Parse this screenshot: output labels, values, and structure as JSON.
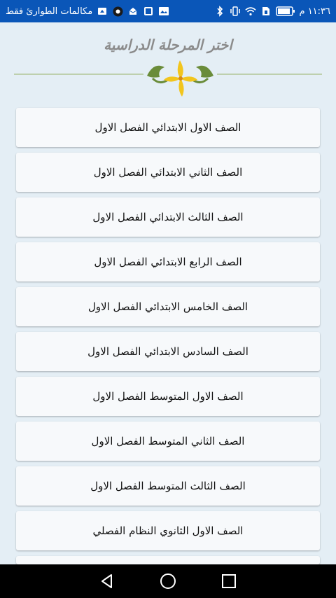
{
  "status_bar": {
    "time": "١١:٣٦ م",
    "carrier_text": "مكالمات الطوارئ فقط",
    "icons": [
      "battery-icon",
      "sim-icon",
      "wifi-icon",
      "vibrate-icon",
      "bluetooth-icon",
      "screenshot-icon",
      "photo-icon",
      "mail-icon",
      "shield-icon",
      "notification-icon"
    ],
    "background_color": "#0a56b8"
  },
  "header": {
    "title": "اختر المرحلة الدراسية",
    "ornament_icon": "floral-ornament-icon"
  },
  "grades": [
    {
      "label": "الصف الاول الابتدائي الفصل الاول"
    },
    {
      "label": "الصف الثاني الابتدائي الفصل الاول"
    },
    {
      "label": "الصف الثالث الابتدائي الفصل الاول"
    },
    {
      "label": "الصف الرابع الابتدائي الفصل الاول"
    },
    {
      "label": "الصف الخامس الابتدائي الفصل الاول"
    },
    {
      "label": "الصف السادس الابتدائي الفصل الاول"
    },
    {
      "label": "الصف الاول المتوسط الفصل الاول"
    },
    {
      "label": "الصف الثاني المتوسط الفصل الاول"
    },
    {
      "label": "الصف الثالث المتوسط الفصل الاول"
    },
    {
      "label": "الصف الاول الثانوي النظام الفصلي"
    },
    {
      "label": ""
    }
  ],
  "nav_bar": {
    "buttons": [
      "back-icon",
      "home-icon",
      "recents-icon"
    ]
  },
  "colors": {
    "background": "#e4eef5",
    "card": "#f7f9fb",
    "ornament_green": "#6a8c3a",
    "ornament_yellow": "#f2c51d"
  }
}
